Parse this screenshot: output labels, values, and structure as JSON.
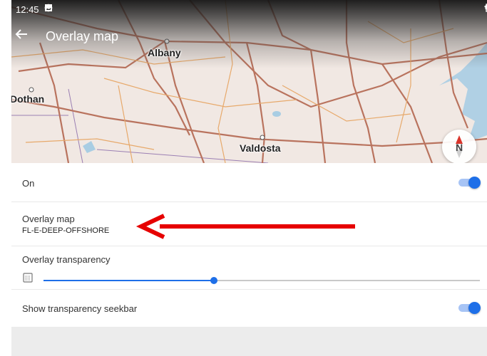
{
  "status": {
    "time": "12:45"
  },
  "appbar": {
    "title": "Overlay map"
  },
  "map": {
    "cities": [
      "Albany",
      "Dothan",
      "Valdosta"
    ],
    "compass_label": "N"
  },
  "settings": {
    "on_label": "On",
    "on_value": true,
    "overlay_label": "Overlay map",
    "overlay_value": "FL-E-DEEP-OFFSHORE",
    "transparency_label": "Overlay transparency",
    "transparency_fraction": 0.39,
    "seekbar_label": "Show transparency seekbar",
    "seekbar_value": true
  },
  "colors": {
    "accent": "#1e6fe8",
    "annotation_arrow": "#e60000"
  }
}
